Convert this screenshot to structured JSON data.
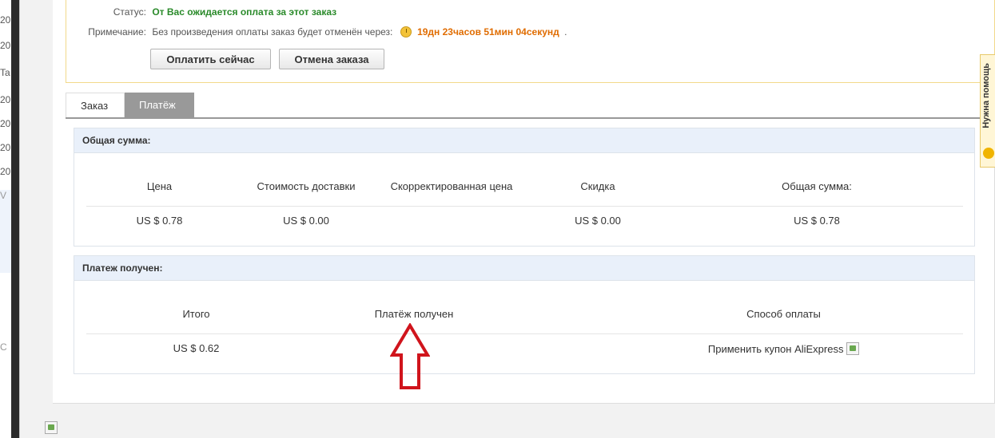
{
  "left_strip": {
    "fragments": [
      "20",
      "20",
      "Ta",
      "20",
      "20",
      "20",
      "20",
      "V",
      "C"
    ]
  },
  "status": {
    "status_label": "Статус:",
    "status_value": "От Вас ожидается оплата за этот заказ",
    "note_label": "Примечание:",
    "note_value": "Без произведения оплаты заказ будет отменён через:",
    "timer_icon": "clock-icon",
    "timer_value": "19дн 23часов 51мин 04секунд",
    "timer_suffix": "."
  },
  "buttons": {
    "pay_now": "Оплатить сейчас",
    "cancel_order": "Отмена заказа"
  },
  "tabs": [
    {
      "label": "Заказ",
      "active": false
    },
    {
      "label": "Платёж",
      "active": true
    }
  ],
  "total_panel": {
    "title": "Общая сумма:",
    "headers": [
      "Цена",
      "Стоимость доставки",
      "Скорректированная цена",
      "Скидка",
      "Общая сумма:"
    ],
    "values": [
      "US $ 0.78",
      "US $ 0.00",
      "",
      "US $ 0.00",
      "US $ 0.78"
    ]
  },
  "payment_panel": {
    "title": "Платеж получен:",
    "headers": [
      "Итого",
      "Платёж получен",
      "Способ оплаты"
    ],
    "values": [
      "US $ 0.62",
      "",
      "Применить купон AliExpress"
    ],
    "method_icon": "broken-image-icon"
  },
  "help_tab": {
    "label": "Нужна помощь"
  },
  "colors": {
    "status_green": "#2a8a2a",
    "timer_orange": "#e06c00",
    "tab_active": "#999999",
    "panel_header": "#e9f0fa",
    "annotation_arrow": "#d0141c"
  }
}
